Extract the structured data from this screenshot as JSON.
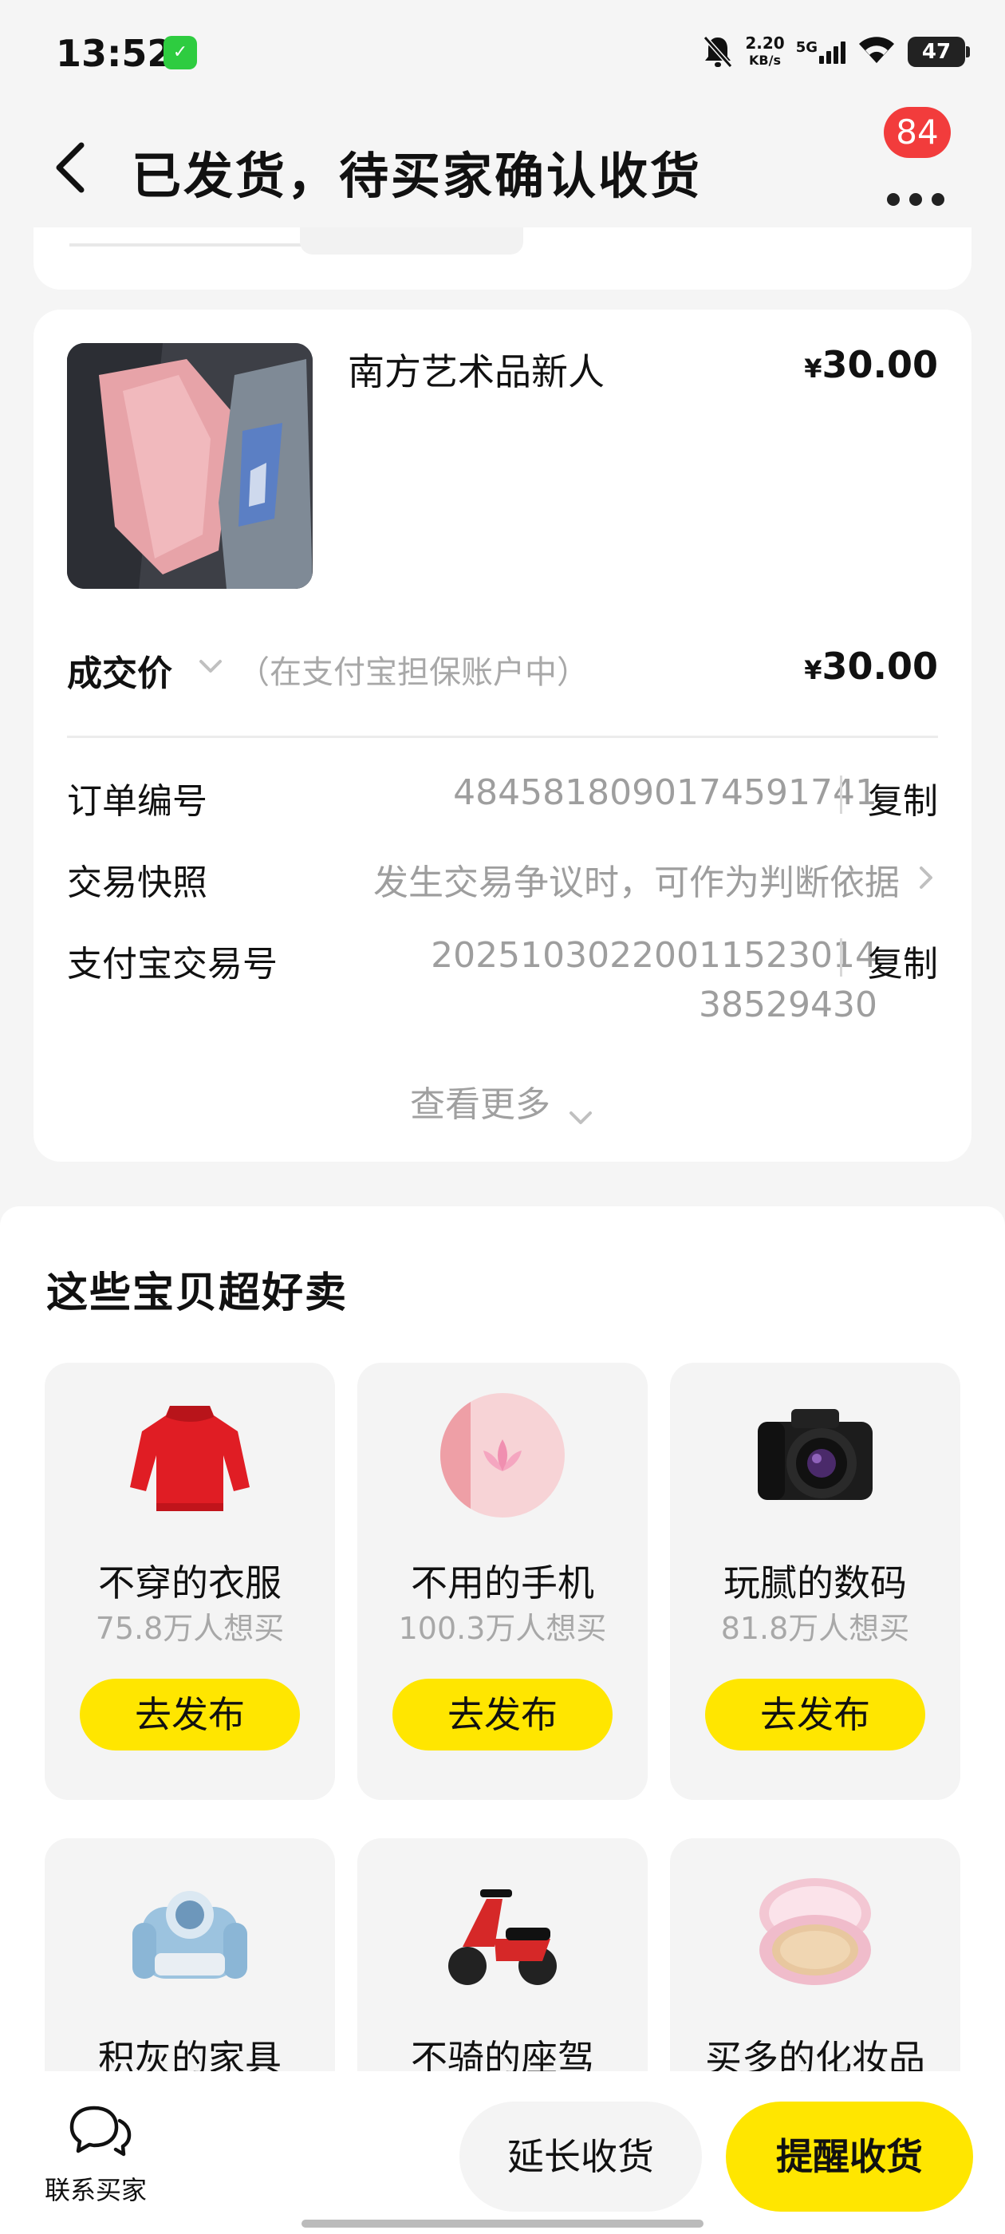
{
  "status_bar": {
    "time": "13:52",
    "net_speed_value": "2.20",
    "net_speed_unit": "KB/s",
    "network": "5G",
    "battery": "47"
  },
  "header": {
    "title": "已发货，待买家确认收货",
    "badge_count": "84"
  },
  "product": {
    "title": "南方艺术品新人",
    "currency": "¥",
    "price": "30.00"
  },
  "deal": {
    "label": "成交价",
    "note": "（在支付宝担保账户中）",
    "currency": "¥",
    "price": "30.00"
  },
  "order_info": {
    "order_no_label": "订单编号",
    "order_no": "4845818090174591741",
    "snapshot_label": "交易快照",
    "snapshot_value": "发生交易争议时，可作为判断依据",
    "alipay_label": "支付宝交易号",
    "alipay_no_line1": "2025103022001152301 4",
    "alipay_no_line1_display": "20251030220011523014",
    "alipay_no_line2": "38529430",
    "copy_label": "复制",
    "view_more": "查看更多"
  },
  "recommend": {
    "title": "这些宝贝超好卖",
    "items": [
      {
        "name": "不穿的衣服",
        "want": "75.8万人想买",
        "button": "去发布"
      },
      {
        "name": "不用的手机",
        "want": "100.3万人想买",
        "button": "去发布"
      },
      {
        "name": "玩腻的数码",
        "want": "81.8万人想买",
        "button": "去发布"
      },
      {
        "name": "积灰的家具",
        "want": "",
        "button": ""
      },
      {
        "name": "不骑的座驾",
        "want": "",
        "button": ""
      },
      {
        "name": "买多的化妆品",
        "want": "",
        "button": ""
      }
    ]
  },
  "bottom_bar": {
    "contact_label": "联系买家",
    "extend_label": "延长收货",
    "remind_label": "提醒收货"
  },
  "colors": {
    "accent_yellow": "#ffe600",
    "badge_red": "#f23c3c",
    "wechat_green": "#2ecc40"
  }
}
